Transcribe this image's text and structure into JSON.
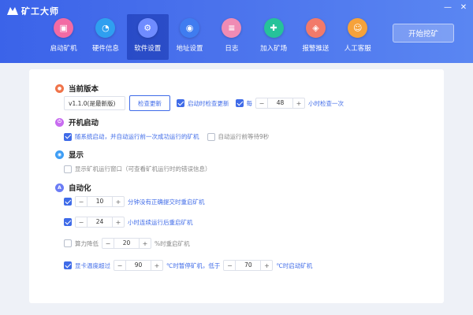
{
  "app": {
    "title": "矿工大师"
  },
  "window": {
    "minimize_label": "—",
    "close_label": "✕"
  },
  "nav": {
    "items": [
      {
        "label": "启动矿机",
        "color": "#f26ba4",
        "glyph": "▣"
      },
      {
        "label": "硬件信息",
        "color": "#2f9ff0",
        "glyph": "◔"
      },
      {
        "label": "软件设置",
        "color": "#6f8cff",
        "glyph": "⚙"
      },
      {
        "label": "地址设置",
        "color": "#3f7cf0",
        "glyph": "◉"
      },
      {
        "label": "日志",
        "color": "#f08bb4",
        "glyph": "≡"
      },
      {
        "label": "加入矿场",
        "color": "#26c29a",
        "glyph": "✚"
      },
      {
        "label": "报警推送",
        "color": "#f27a6a",
        "glyph": "◈"
      },
      {
        "label": "人工客服",
        "color": "#f6a23a",
        "glyph": "☺"
      }
    ],
    "active_index": 2
  },
  "start_button": {
    "label": "开始挖矿"
  },
  "sections": {
    "version": {
      "title": "当前版本",
      "icon_color": "#f0744a",
      "version_text": "v1.1.0(是最新版)",
      "check_button": "检查更新",
      "check_on_start": {
        "label": "启动时检查更新",
        "checked": true
      },
      "periodic": {
        "prefix": "每",
        "value": "48",
        "suffix": "小时检查一次",
        "checked": true
      }
    },
    "boot": {
      "title": "开机启动",
      "icon_color": "#c86cf0",
      "auto_start": {
        "label": "随系统启动，并自动运行前一次成功运行的矿机",
        "checked": true
      },
      "wait": {
        "label": "自动运行前等待9秒",
        "checked": false
      }
    },
    "display": {
      "title": "显示",
      "icon_color": "#3f9ef5",
      "show_window": {
        "label": "显示矿机运行窗口（可查看矿机运行时的错误信息）",
        "checked": false
      }
    },
    "automation": {
      "title": "自动化",
      "icon_color": "#6b7cf5",
      "rule1": {
        "value": "10",
        "suffix": "分钟没有正确提交时重启矿机",
        "checked": true
      },
      "rule2": {
        "value": "24",
        "suffix": "小时连续运行后重启矿机",
        "checked": true
      },
      "rule3": {
        "prefix": "算力降低",
        "value": "20",
        "suffix": "%时重启矿机",
        "checked": false
      },
      "rule4": {
        "prefix": "显卡温度超过",
        "value": "90",
        "middle": "℃时暂停矿机，低于",
        "value2": "70",
        "suffix": "℃时启动矿机",
        "checked": true
      }
    }
  },
  "stepper": {
    "minus": "−",
    "plus": "+"
  }
}
